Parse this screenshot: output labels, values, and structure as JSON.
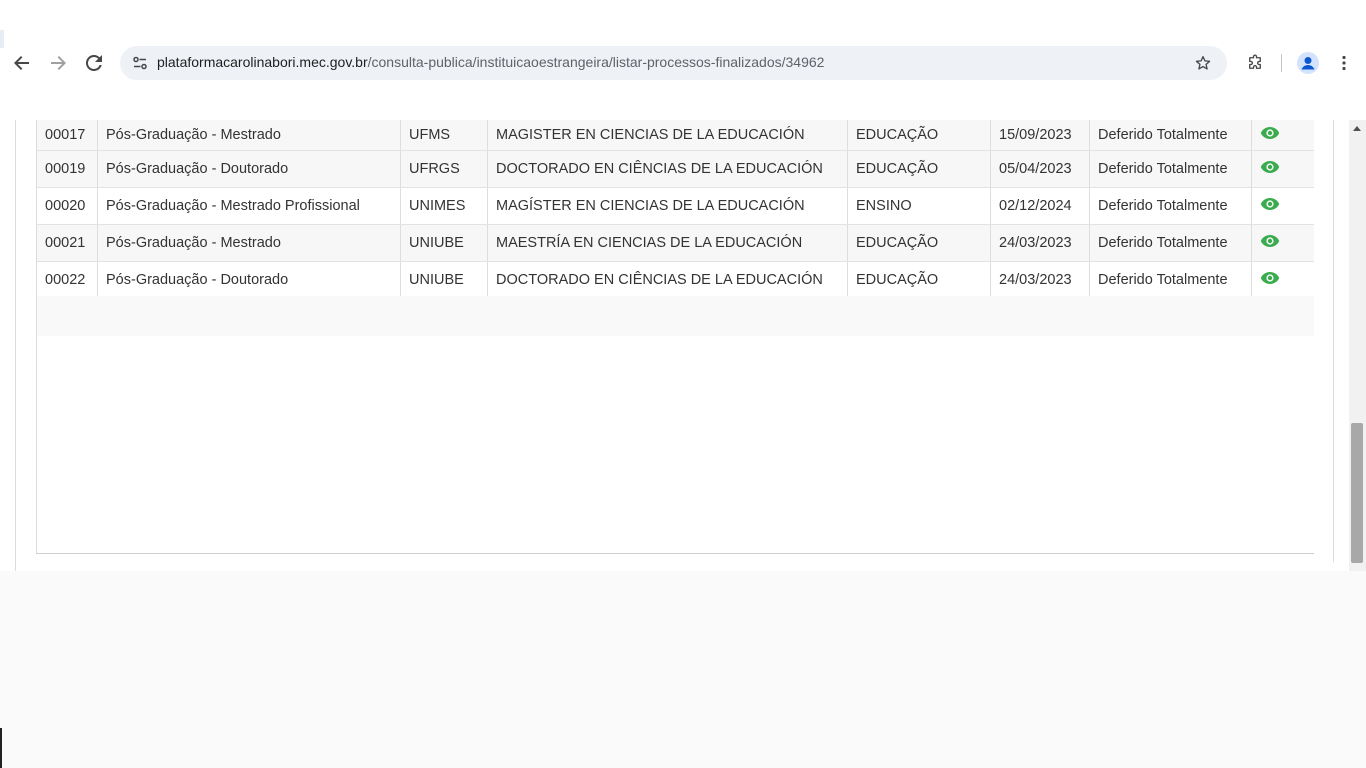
{
  "browser": {
    "url_host": "plataformacarolinabori.mec.gov.br",
    "url_path": "/consulta-publica/instituicaoestrangeira/listar-processos-finalizados/34962"
  },
  "table": {
    "rows": [
      {
        "num": "00017",
        "tipo": "Pós-Graduação - Mestrado",
        "ies": "UFMS",
        "curso": "MAGISTER EN CIENCIAS DE LA EDUCACIÓN",
        "area": "EDUCAÇÃO",
        "data": "15/09/2023",
        "situacao": "Deferido Totalmente"
      },
      {
        "num": "00019",
        "tipo": "Pós-Graduação - Doutorado",
        "ies": "UFRGS",
        "curso": "DOCTORADO EN CIÊNCIAS DE LA EDUCACIÓN",
        "area": "EDUCAÇÃO",
        "data": "05/04/2023",
        "situacao": "Deferido Totalmente"
      },
      {
        "num": "00020",
        "tipo": "Pós-Graduação - Mestrado Profissional",
        "ies": "UNIMES",
        "curso": "MAGÍSTER EN CIENCIAS DE LA EDUCACIÓN",
        "area": "ENSINO",
        "data": "02/12/2024",
        "situacao": "Deferido Totalmente"
      },
      {
        "num": "00021",
        "tipo": "Pós-Graduação - Mestrado",
        "ies": "UNIUBE",
        "curso": "MAESTRÍA EN CIENCIAS DE LA EDUCACIÓN",
        "area": "EDUCAÇÃO",
        "data": "24/03/2023",
        "situacao": "Deferido Totalmente"
      },
      {
        "num": "00022",
        "tipo": "Pós-Graduação - Doutorado",
        "ies": "UNIUBE",
        "curso": "DOCTORADO EN CIÊNCIAS DE LA EDUCACIÓN",
        "area": "EDUCAÇÃO",
        "data": "24/03/2023",
        "situacao": "Deferido Totalmente"
      }
    ]
  },
  "colors": {
    "view_icon": "#3bab4f"
  },
  "icons": [
    "back-arrow-icon",
    "forward-arrow-icon",
    "reload-icon",
    "site-info-icon",
    "star-icon",
    "extensions-icon",
    "profile-icon",
    "kebab-menu-icon",
    "eye-icon"
  ]
}
